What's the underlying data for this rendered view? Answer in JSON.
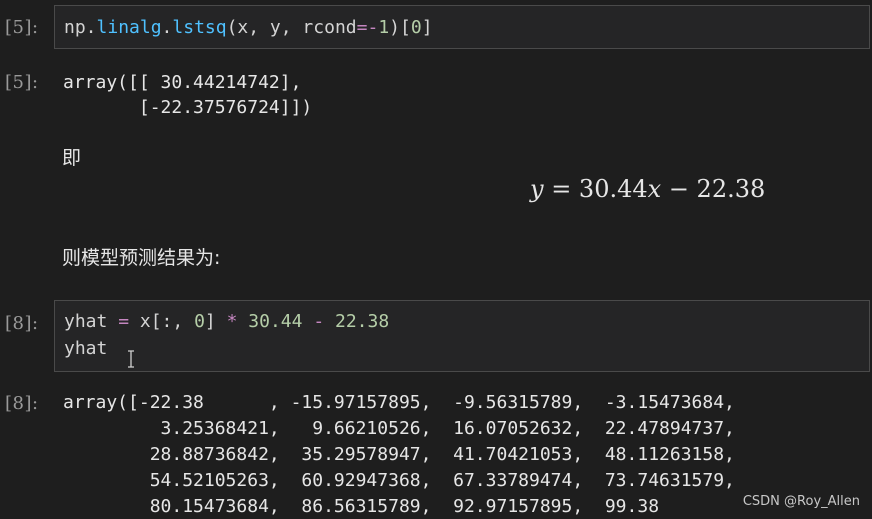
{
  "cells": [
    {
      "prompt": "[5]:",
      "code": {
        "np_prefix": "np.",
        "linalg": "linalg",
        "dot": ".",
        "lstsq": "lstsq",
        "args_open": "(x, y, rcond",
        "eq": "=",
        "neg": "-",
        "one": "1",
        "args_close": ")[",
        "zero": "0",
        "end": "]"
      },
      "output_prompt": "[5]:",
      "output_lines": [
        "array([[ 30.44214742],",
        "       [-22.37576724]])"
      ]
    },
    {
      "prompt": "[8]:",
      "code": {
        "line1_a": "yhat ",
        "line1_eq": "=",
        "line1_b": " x[:, ",
        "line1_zero": "0",
        "line1_c": "] ",
        "line1_mul": "*",
        "line1_d": " ",
        "line1_n1": "30.44",
        "line1_e": " ",
        "line1_minus": "-",
        "line1_f": " ",
        "line1_n2": "22.38",
        "line2": "yhat"
      },
      "output_prompt": "[8]:",
      "output_lines": [
        "array([-22.38      , -15.97157895,  -9.56315789,  -3.15473684,",
        "         3.25368421,   9.66210526,  16.07052632,  22.47894737,",
        "        28.88736842,  35.29578947,  41.70421053,  48.11263158,",
        "        54.52105263,  60.92947368,  67.33789474,  73.74631579,",
        "        80.15473684,  86.56315789,  92.97157895,  99.38"
      ]
    }
  ],
  "markdown": {
    "ji": "即",
    "equation": {
      "y": "y",
      "mid": " = 30.44",
      "x": "x",
      "tail": " − 22.38"
    },
    "result_text": "则模型预测结果为:"
  },
  "watermark": "CSDN @Roy_Allen",
  "colors": {
    "background": "#1e1e1e",
    "cell_border": "#4a4a4a",
    "function": "#4fc1ff",
    "number": "#b5cea8",
    "operator": "#c586c0"
  },
  "icons": {
    "text_cursor": "i-beam-cursor-icon"
  }
}
